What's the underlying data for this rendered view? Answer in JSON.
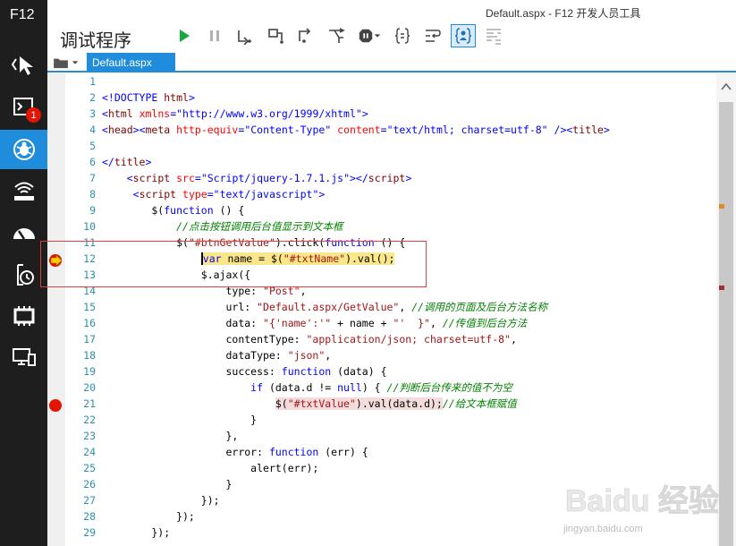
{
  "window": {
    "title": "Default.aspx - F12 开发人员工具"
  },
  "rail": {
    "label": "F12",
    "console_badge": "1"
  },
  "toolbar": {
    "title": "调试程序"
  },
  "document_tab": {
    "label": "Default.aspx"
  },
  "editor": {
    "line_numbers": [
      "1",
      "2",
      "3",
      "4",
      "5",
      "6",
      "7",
      "8",
      "9",
      "10",
      "11",
      "12",
      "13",
      "14",
      "15",
      "16",
      "17",
      "18",
      "19",
      "20",
      "21",
      "22",
      "23",
      "24",
      "25",
      "26",
      "27",
      "28",
      "29"
    ],
    "breakpoint_line": "21",
    "current_line": "12"
  },
  "colors": {
    "accent": "#1f8ddb",
    "rail": "#1e1e1e",
    "breakpoint": "#e51400",
    "highlight": "#fbe78a"
  },
  "code_lines": [
    {
      "p": []
    },
    {
      "p": [
        {
          "c": "k",
          "t": "<!DOCTYPE "
        },
        {
          "c": "tg",
          "t": "html"
        },
        {
          "c": "k",
          "t": ">"
        }
      ]
    },
    {
      "p": [
        {
          "c": "k",
          "t": "<"
        },
        {
          "c": "tg",
          "t": "html "
        },
        {
          "c": "at",
          "t": "xmlns"
        },
        {
          "c": "k",
          "t": "="
        },
        {
          "c": "sb",
          "t": "\"http://www.w3.org/1999/xhtml\""
        },
        {
          "c": "k",
          "t": ">"
        }
      ]
    },
    {
      "p": [
        {
          "c": "k",
          "t": "<"
        },
        {
          "c": "tg",
          "t": "head"
        },
        {
          "c": "k",
          "t": "><"
        },
        {
          "c": "tg",
          "t": "meta "
        },
        {
          "c": "at",
          "t": "http-equiv"
        },
        {
          "c": "k",
          "t": "="
        },
        {
          "c": "sb",
          "t": "\"Content-Type\" "
        },
        {
          "c": "at",
          "t": "content"
        },
        {
          "c": "k",
          "t": "="
        },
        {
          "c": "sb",
          "t": "\"text/html; charset=utf-8\""
        },
        {
          "c": "k",
          "t": " /><"
        },
        {
          "c": "tg",
          "t": "title"
        },
        {
          "c": "k",
          "t": ">"
        }
      ]
    },
    {
      "p": []
    },
    {
      "p": [
        {
          "c": "k",
          "t": "</"
        },
        {
          "c": "tg",
          "t": "title"
        },
        {
          "c": "k",
          "t": ">"
        }
      ]
    },
    {
      "p": [
        {
          "c": "",
          "t": "    "
        },
        {
          "c": "k",
          "t": "<"
        },
        {
          "c": "tg",
          "t": "script "
        },
        {
          "c": "at",
          "t": "src"
        },
        {
          "c": "k",
          "t": "="
        },
        {
          "c": "sb",
          "t": "\"Script/jquery-1.7.1.js\""
        },
        {
          "c": "k",
          "t": "></"
        },
        {
          "c": "tg",
          "t": "script"
        },
        {
          "c": "k",
          "t": ">"
        }
      ]
    },
    {
      "p": [
        {
          "c": "",
          "t": "     "
        },
        {
          "c": "k",
          "t": "<"
        },
        {
          "c": "tg",
          "t": "script "
        },
        {
          "c": "at",
          "t": "type"
        },
        {
          "c": "k",
          "t": "="
        },
        {
          "c": "sb",
          "t": "\"text/javascript\""
        },
        {
          "c": "k",
          "t": ">"
        }
      ]
    },
    {
      "p": [
        {
          "c": "",
          "t": "        $("
        },
        {
          "c": "k",
          "t": "function"
        },
        {
          "c": "",
          "t": " () {"
        }
      ]
    },
    {
      "p": [
        {
          "c": "",
          "t": "            "
        },
        {
          "c": "c",
          "t": "//点击按钮调用后台值显示到文本框"
        }
      ]
    },
    {
      "p": [
        {
          "c": "",
          "t": "            $("
        },
        {
          "c": "s",
          "t": "\"#btnGetValue\""
        },
        {
          "c": "",
          "t": ").click("
        },
        {
          "c": "k",
          "t": "function"
        },
        {
          "c": "",
          "t": " () {"
        }
      ]
    },
    {
      "p": [
        {
          "c": "",
          "t": "                "
        },
        {
          "c": "hl cur k",
          "t": "var"
        },
        {
          "c": "hl",
          "t": " name = $("
        },
        {
          "c": "hl s",
          "t": "\"#txtName\""
        },
        {
          "c": "hl",
          "t": ").val();"
        }
      ]
    },
    {
      "p": [
        {
          "c": "",
          "t": "                $.ajax({"
        }
      ]
    },
    {
      "p": [
        {
          "c": "",
          "t": "                    type: "
        },
        {
          "c": "s",
          "t": "\"Post\""
        },
        {
          "c": "",
          "t": ","
        }
      ]
    },
    {
      "p": [
        {
          "c": "",
          "t": "                    url: "
        },
        {
          "c": "s",
          "t": "\"Default.aspx/GetValue\""
        },
        {
          "c": "",
          "t": ", "
        },
        {
          "c": "c",
          "t": "//调用的页面及后台方法名称"
        }
      ]
    },
    {
      "p": [
        {
          "c": "",
          "t": "                    data: "
        },
        {
          "c": "s",
          "t": "\"{'name':'\""
        },
        {
          "c": "",
          "t": " + name + "
        },
        {
          "c": "s",
          "t": "\"'  }\""
        },
        {
          "c": "",
          "t": ", "
        },
        {
          "c": "c",
          "t": "//传值到后台方法"
        }
      ]
    },
    {
      "p": [
        {
          "c": "",
          "t": "                    contentType: "
        },
        {
          "c": "s",
          "t": "\"application/json; charset=utf-8\""
        },
        {
          "c": "",
          "t": ","
        }
      ]
    },
    {
      "p": [
        {
          "c": "",
          "t": "                    dataType: "
        },
        {
          "c": "s",
          "t": "\"json\""
        },
        {
          "c": "",
          "t": ","
        }
      ]
    },
    {
      "p": [
        {
          "c": "",
          "t": "                    success: "
        },
        {
          "c": "k",
          "t": "function"
        },
        {
          "c": "",
          "t": " (data) {"
        }
      ]
    },
    {
      "p": [
        {
          "c": "",
          "t": "                        "
        },
        {
          "c": "k",
          "t": "if"
        },
        {
          "c": "",
          "t": " (data.d != "
        },
        {
          "c": "k",
          "t": "null"
        },
        {
          "c": "",
          "t": ") { "
        },
        {
          "c": "c",
          "t": "//判断后台传来的值不为空"
        }
      ]
    },
    {
      "p": [
        {
          "c": "",
          "t": "                            "
        },
        {
          "c": "hl2",
          "t": "$("
        },
        {
          "c": "hl2 s",
          "t": "\"#txtValue\""
        },
        {
          "c": "hl2",
          "t": ").val(data.d);"
        },
        {
          "c": "c",
          "t": "//给文本框赋值"
        }
      ]
    },
    {
      "p": [
        {
          "c": "",
          "t": "                        }"
        }
      ]
    },
    {
      "p": [
        {
          "c": "",
          "t": "                    },"
        }
      ]
    },
    {
      "p": [
        {
          "c": "",
          "t": "                    error: "
        },
        {
          "c": "k",
          "t": "function"
        },
        {
          "c": "",
          "t": " (err) {"
        }
      ]
    },
    {
      "p": [
        {
          "c": "",
          "t": "                        alert(err);"
        }
      ]
    },
    {
      "p": [
        {
          "c": "",
          "t": "                    }"
        }
      ]
    },
    {
      "p": [
        {
          "c": "",
          "t": "                });"
        }
      ]
    },
    {
      "p": [
        {
          "c": "",
          "t": "            });"
        }
      ]
    },
    {
      "p": [
        {
          "c": "",
          "t": "        });"
        }
      ]
    }
  ],
  "watermark": {
    "brand": "Baidu 经验",
    "url": "jingyan.baidu.com"
  }
}
